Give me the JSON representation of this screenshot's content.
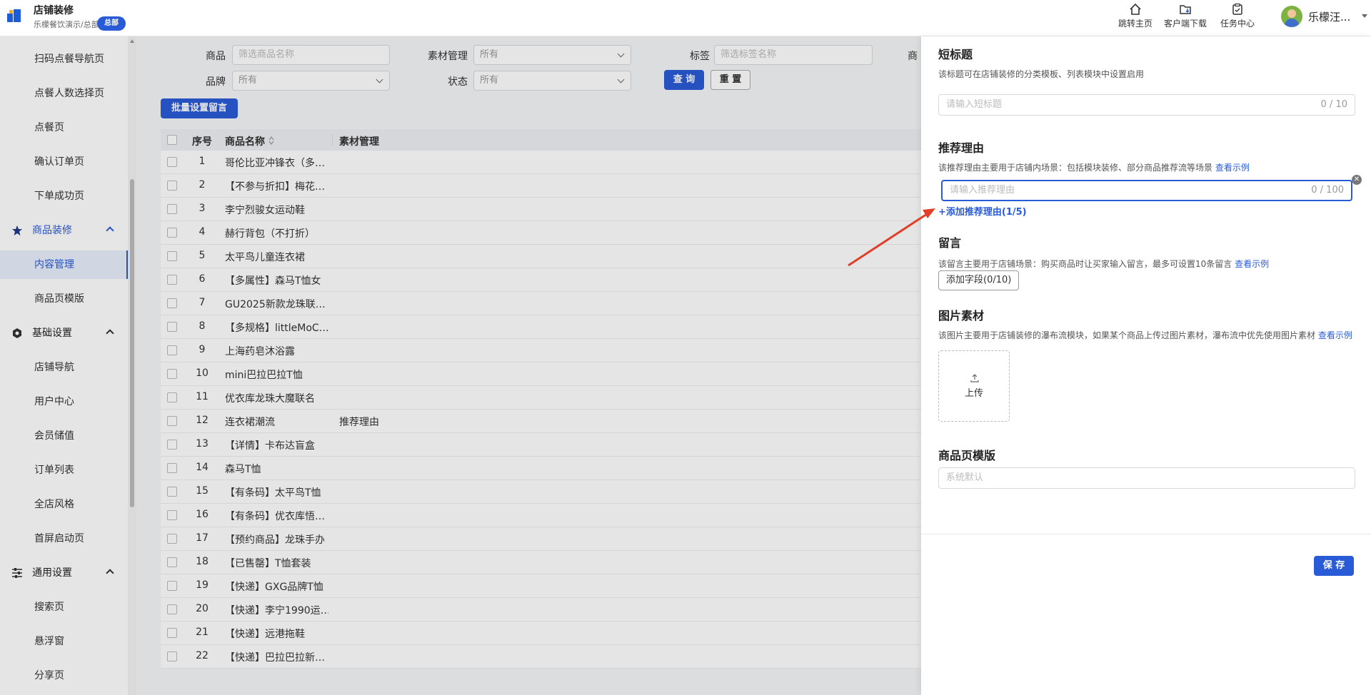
{
  "header": {
    "title": "店铺装修",
    "subtitle": "乐檬餐饮演示/总部",
    "badge": "总部",
    "nav": [
      {
        "label": "跳转主页",
        "icon": "home-icon"
      },
      {
        "label": "客户端下载",
        "icon": "download-folder-icon"
      },
      {
        "label": "任务中心",
        "icon": "clipboard-icon"
      }
    ],
    "user_name": "乐檬汪..."
  },
  "sidebar": {
    "items": [
      {
        "label": "扫码点餐导航页"
      },
      {
        "label": "点餐人数选择页"
      },
      {
        "label": "点餐页"
      },
      {
        "label": "确认订单页"
      },
      {
        "label": "下单成功页"
      }
    ],
    "group_goods": {
      "label": "商品装修",
      "icon": "star-icon"
    },
    "goods_items": [
      {
        "label": "内容管理",
        "active": true
      },
      {
        "label": "商品页模版"
      }
    ],
    "group_basic": {
      "label": "基础设置",
      "icon": "hexagon-icon"
    },
    "basic_items": [
      {
        "label": "店铺导航"
      },
      {
        "label": "用户中心"
      },
      {
        "label": "会员储值"
      },
      {
        "label": "订单列表"
      },
      {
        "label": "全店风格"
      },
      {
        "label": "首屏启动页"
      }
    ],
    "group_general": {
      "label": "通用设置",
      "icon": "sliders-icon"
    },
    "general_items": [
      {
        "label": "搜索页"
      },
      {
        "label": "悬浮窗"
      },
      {
        "label": "分享页"
      }
    ]
  },
  "filters": {
    "goods_label": "商品",
    "goods_placeholder": "筛选商品名称",
    "material_label": "素材管理",
    "material_value": "所有",
    "tag_label": "标签",
    "tag_placeholder": "筛选标签名称",
    "cut_label": "商",
    "brand_label": "品牌",
    "brand_value": "所有",
    "status_label": "状态",
    "status_value": "所有",
    "query_button": "查 询",
    "reset_button": "重 置",
    "batch_button": "批量设置留言"
  },
  "table": {
    "headers": {
      "seq": "序号",
      "name": "商品名称",
      "material": "素材管理"
    },
    "rows": [
      {
        "seq": "1",
        "name": "哥伦比亚冲锋衣（多…",
        "material": ""
      },
      {
        "seq": "2",
        "name": "【不参与折扣】梅花…",
        "material": ""
      },
      {
        "seq": "3",
        "name": "李宁烈骏女运动鞋",
        "material": ""
      },
      {
        "seq": "4",
        "name": "赫行背包（不打折）",
        "material": ""
      },
      {
        "seq": "5",
        "name": "太平鸟儿童连衣裙",
        "material": ""
      },
      {
        "seq": "6",
        "name": "【多属性】森马T恤女",
        "material": ""
      },
      {
        "seq": "7",
        "name": "GU2025新款龙珠联…",
        "material": ""
      },
      {
        "seq": "8",
        "name": "【多规格】littleMoC…",
        "material": ""
      },
      {
        "seq": "9",
        "name": "上海药皂沐浴露",
        "material": ""
      },
      {
        "seq": "10",
        "name": "mini巴拉巴拉T恤",
        "material": ""
      },
      {
        "seq": "11",
        "name": "优衣库龙珠大魔联名",
        "material": ""
      },
      {
        "seq": "12",
        "name": "连衣裙潮流",
        "material": "推荐理由"
      },
      {
        "seq": "13",
        "name": "【详情】卡布达盲盒",
        "material": ""
      },
      {
        "seq": "14",
        "name": "森马T恤",
        "material": ""
      },
      {
        "seq": "15",
        "name": "【有条码】太平鸟T恤",
        "material": ""
      },
      {
        "seq": "16",
        "name": "【有条码】优衣库悟…",
        "material": ""
      },
      {
        "seq": "17",
        "name": "【预约商品】龙珠手办",
        "material": ""
      },
      {
        "seq": "18",
        "name": "【已售罄】T恤套装",
        "material": ""
      },
      {
        "seq": "19",
        "name": "【快递】GXG品牌T恤",
        "material": ""
      },
      {
        "seq": "20",
        "name": "【快递】李宁1990运…",
        "material": ""
      },
      {
        "seq": "21",
        "name": "【快递】远港拖鞋",
        "material": ""
      },
      {
        "seq": "22",
        "name": "【快递】巴拉巴拉新…",
        "material": ""
      }
    ]
  },
  "drawer": {
    "short_title": {
      "heading": "短标题",
      "desc": "该标题可在店铺装修的分类模板、列表模块中设置启用",
      "placeholder": "请输入短标题",
      "count": "0 / 10"
    },
    "reason": {
      "heading": "推荐理由",
      "desc": "该推荐理由主要用于店铺内场景：包括模块装修、部分商品推荐流等场景",
      "example_link": "查看示例",
      "placeholder": "请输入推荐理由",
      "count": "0 / 100",
      "add_link": "+添加推荐理由(1/5)"
    },
    "message": {
      "heading": "留言",
      "desc": "该留言主要用于店铺场景：购买商品时让买家输入留言，最多可设置10条留言",
      "example_link": "查看示例",
      "add_field": "添加字段(0/10)"
    },
    "image": {
      "heading": "图片素材",
      "desc": "该图片主要用于店铺装修的瀑布流模块，如果某个商品上传过图片素材，瀑布流中优先使用图片素材",
      "example_link": "查看示例",
      "upload_label": "上传"
    },
    "template": {
      "heading": "商品页模版",
      "placeholder": "系统默认"
    },
    "save_button": "保 存"
  },
  "colors": {
    "primary": "#2a5bd7",
    "annotation_arrow": "#e0402a"
  }
}
